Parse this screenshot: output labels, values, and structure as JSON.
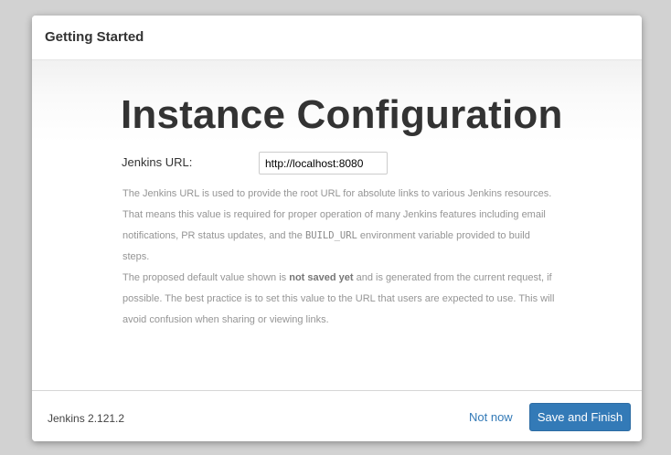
{
  "dialog": {
    "title": "Getting Started"
  },
  "main": {
    "heading": "Instance Configuration",
    "url_label": "Jenkins URL:",
    "url_value": "http://localhost:8080",
    "help": {
      "p1_text1": "The Jenkins URL is used to provide the root URL for absolute links to various Jenkins resources. That means this value is required for proper operation of many Jenkins features including email notifications, PR status updates, and the ",
      "p1_code": "BUILD_URL",
      "p1_text2": " environment variable provided to build steps.",
      "p2_text1": "The proposed default value shown is ",
      "p2_strong": "not saved yet",
      "p2_text2": " and is generated from the current request, if possible. The best practice is to set this value to the URL that users are expected to use. This will avoid confusion when sharing or viewing links."
    }
  },
  "footer": {
    "version": "Jenkins 2.121.2",
    "not_now_label": "Not now",
    "save_label": "Save and Finish"
  },
  "colors": {
    "primary": "#337ab7",
    "background": "#d2d2d2"
  }
}
